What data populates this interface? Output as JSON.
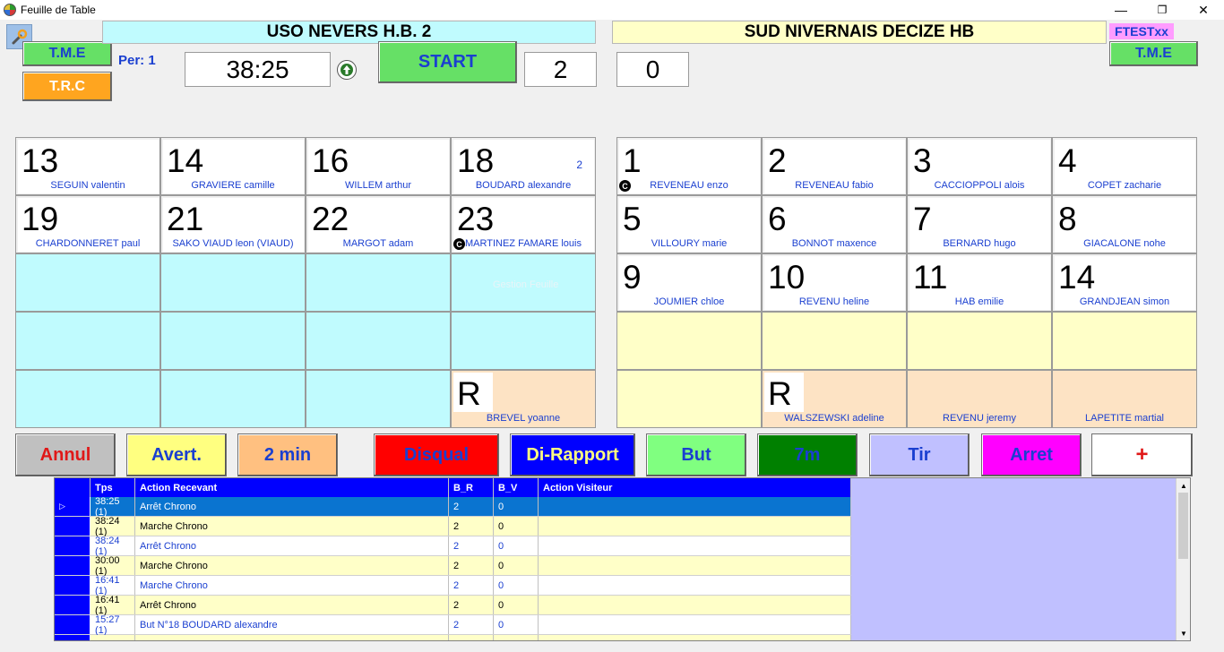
{
  "window": {
    "title": "Feuille de Table",
    "minimize": "—",
    "restore": "❐",
    "close": "✕"
  },
  "header": {
    "tme_left": "T.M.E",
    "trc": "T.R.C",
    "period": "Per: 1",
    "clock": "38:25",
    "start": "START",
    "home_score": "2",
    "away_score": "0",
    "home_team": "USO NEVERS H.B. 2",
    "away_team": "SUD NIVERNAIS DECIZE HB",
    "ftest": "FTESTxx",
    "tme_right": "T.M.E"
  },
  "home_players": [
    {
      "num": "13",
      "name": "SEGUIN valentin"
    },
    {
      "num": "14",
      "name": "GRAVIERE camille"
    },
    {
      "num": "16",
      "name": "WILLEM arthur"
    },
    {
      "num": "18",
      "name": "BOUDARD alexandre",
      "goals": "2"
    },
    {
      "num": "19",
      "name": "CHARDONNERET paul"
    },
    {
      "num": "21",
      "name": "SAKO VIAUD leon (VIAUD)"
    },
    {
      "num": "22",
      "name": "MARGOT adam"
    },
    {
      "num": "23",
      "name": "MARTINEZ FAMARE louis",
      "captain": "C"
    }
  ],
  "home_sub": {
    "num": "R",
    "name": "BREVEL yoanne"
  },
  "home_ghost": "Gestion Feuille",
  "away_players": [
    {
      "num": "1",
      "name": "REVENEAU enzo",
      "captain": "C"
    },
    {
      "num": "2",
      "name": "REVENEAU fabio"
    },
    {
      "num": "3",
      "name": "CACCIOPPOLI alois"
    },
    {
      "num": "4",
      "name": "COPET zacharie"
    },
    {
      "num": "5",
      "name": "VILLOURY marie"
    },
    {
      "num": "6",
      "name": "BONNOT maxence"
    },
    {
      "num": "7",
      "name": "BERNARD hugo"
    },
    {
      "num": "8",
      "name": "GIACALONE nohe"
    },
    {
      "num": "9",
      "name": "JOUMIER chloe"
    },
    {
      "num": "10",
      "name": "REVENU heline"
    },
    {
      "num": "11",
      "name": "HAB emilie"
    },
    {
      "num": "14",
      "name": "GRANDJEAN simon"
    }
  ],
  "away_subs": [
    {
      "num": "R",
      "name": "WALSZEWSKI adeline"
    },
    {
      "num": "",
      "name": "REVENU jeremy"
    },
    {
      "num": "",
      "name": "LAPETITE martial"
    }
  ],
  "actions": [
    {
      "label": "Annul",
      "bg": "#c0c0c0",
      "fg": "#e01818"
    },
    {
      "label": "Avert.",
      "bg": "#ffff80",
      "fg": "#1a3fd0"
    },
    {
      "label": "2 min",
      "bg": "#ffc080",
      "fg": "#1a3fd0"
    },
    {
      "label": "Disqual",
      "bg": "#ff0000",
      "fg": "#1a3fd0"
    },
    {
      "label": "Di-Rapport",
      "bg": "#0000ff",
      "fg": "#ffff80"
    },
    {
      "label": "But",
      "bg": "#80ff80",
      "fg": "#1a3fd0"
    },
    {
      "label": "7m",
      "bg": "#008000",
      "fg": "#1a3fd0"
    },
    {
      "label": "Tir",
      "bg": "#c0c0ff",
      "fg": "#1a3fd0"
    },
    {
      "label": "Arret",
      "bg": "#ff00ff",
      "fg": "#1a3fd0"
    },
    {
      "label": "+",
      "bg": "#ffffff",
      "fg": "#e01818"
    }
  ],
  "table": {
    "headers": {
      "tps": "Tps",
      "recv": "Action Recevant",
      "br": "B_R",
      "bv": "B_V",
      "vis": "Action Visiteur"
    },
    "rows": [
      {
        "tps": "38:25 (1)",
        "recv": "Arrêt Chrono",
        "br": "2",
        "bv": "0",
        "vis": "",
        "marker": "▷"
      },
      {
        "tps": "38:24 (1)",
        "recv": "Marche Chrono",
        "br": "2",
        "bv": "0",
        "vis": ""
      },
      {
        "tps": "38:24 (1)",
        "recv": "Arrêt Chrono",
        "br": "2",
        "bv": "0",
        "vis": ""
      },
      {
        "tps": "30:00 (1)",
        "recv": "Marche Chrono",
        "br": "2",
        "bv": "0",
        "vis": ""
      },
      {
        "tps": "16:41 (1)",
        "recv": "Marche Chrono",
        "br": "2",
        "bv": "0",
        "vis": ""
      },
      {
        "tps": "16:41 (1)",
        "recv": "Arrêt Chrono",
        "br": "2",
        "bv": "0",
        "vis": ""
      },
      {
        "tps": "15:27 (1)",
        "recv": "But N°18 BOUDARD alexandre",
        "br": "2",
        "bv": "0",
        "vis": ""
      },
      {
        "tps": "",
        "recv": "",
        "br": "",
        "bv": "",
        "vis": ""
      }
    ]
  }
}
